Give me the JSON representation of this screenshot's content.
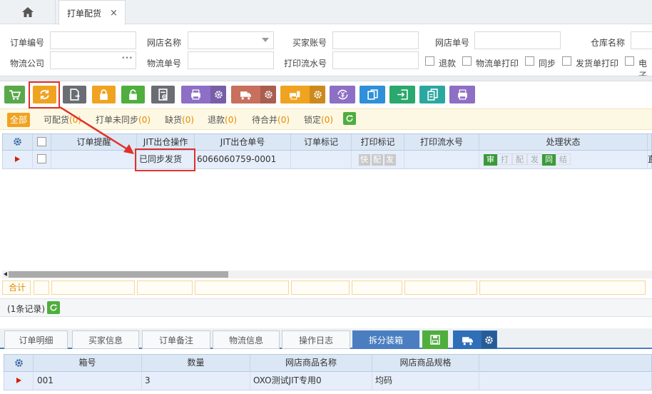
{
  "tabs": {
    "home_icon": "home-icon",
    "active_tab": "打单配货",
    "close": "×"
  },
  "search": {
    "order_no_label": "订单编号",
    "shop_name_label": "网店名称",
    "buyer_account_label": "买家账号",
    "shop_order_label": "网店单号",
    "warehouse_label": "仓库名称",
    "logistics_company_label": "物流公司",
    "logistics_no_label": "物流单号",
    "print_serial_label": "打印流水号",
    "logistics_company_ellipsis": "•••",
    "checks": [
      "退款",
      "物流单打印",
      "同步",
      "发货单打印",
      "电子"
    ]
  },
  "toolbar": {
    "buttons": [
      {
        "icon": "cart-icon",
        "color": "#5aa84a"
      },
      {
        "icon": "sync-icon",
        "color": "#f0a321"
      },
      {
        "icon": "export-doc-icon",
        "color": "#6a6d73"
      },
      {
        "icon": "lock-icon",
        "color": "#f0a321"
      },
      {
        "icon": "unlock-icon",
        "color": "#4fae3d"
      },
      {
        "icon": "doc-remove-icon",
        "color": "#6a6d73"
      },
      {
        "icon": "print-icon",
        "color": "#8e6fc6"
      },
      {
        "icon": "truck-icon",
        "color": "#c86f5d"
      },
      {
        "icon": "print-invoice-icon",
        "color": "#f0a321"
      },
      {
        "icon": "currency-refresh-icon",
        "color": "#8e6fc6"
      },
      {
        "icon": "copy-icon",
        "color": "#2f8fd8"
      },
      {
        "icon": "import-icon",
        "color": "#2aa86d"
      },
      {
        "icon": "duplicate-icon",
        "color": "#2aa8a0"
      },
      {
        "icon": "print-alt-icon",
        "color": "#8e6fc6"
      }
    ]
  },
  "filters": [
    {
      "label": "全部",
      "count": ""
    },
    {
      "label": "可配货",
      "count": "(0)"
    },
    {
      "label": "打单未同步",
      "count": "(0)"
    },
    {
      "label": "缺货",
      "count": "(0)"
    },
    {
      "label": "退款",
      "count": "(0)"
    },
    {
      "label": "待合并",
      "count": "(0)"
    },
    {
      "label": "锁定",
      "count": "(0)"
    }
  ],
  "grid": {
    "headers": [
      "订单提醒",
      "JIT出仓操作",
      "JIT出仓单号",
      "订单标记",
      "打印标记",
      "打印流水号",
      "处理状态"
    ],
    "row": {
      "jit_op": "已同步发货",
      "jit_no": "6066060759-0001",
      "print_marks": [
        "快",
        "配",
        "发"
      ],
      "status": [
        {
          "t": "审",
          "on": true
        },
        {
          "t": "打",
          "on": false
        },
        {
          "t": "配",
          "on": false
        },
        {
          "t": "发",
          "on": false
        },
        {
          "t": "同",
          "on": true
        },
        {
          "t": "结",
          "on": false
        }
      ],
      "trailing": "直"
    }
  },
  "summary": {
    "label": "合计"
  },
  "pager": {
    "text": "(1条记录)"
  },
  "bottom_tabs": [
    "订单明细",
    "买家信息",
    "订单备注",
    "物流信息",
    "操作日志",
    "拆分装箱"
  ],
  "bottom_grid": {
    "headers": [
      "箱号",
      "数量",
      "网店商品名称",
      "网店商品规格"
    ],
    "row": {
      "box": "001",
      "qty": "3",
      "name": "OXO测试JIT专用0",
      "spec": "均码"
    }
  }
}
